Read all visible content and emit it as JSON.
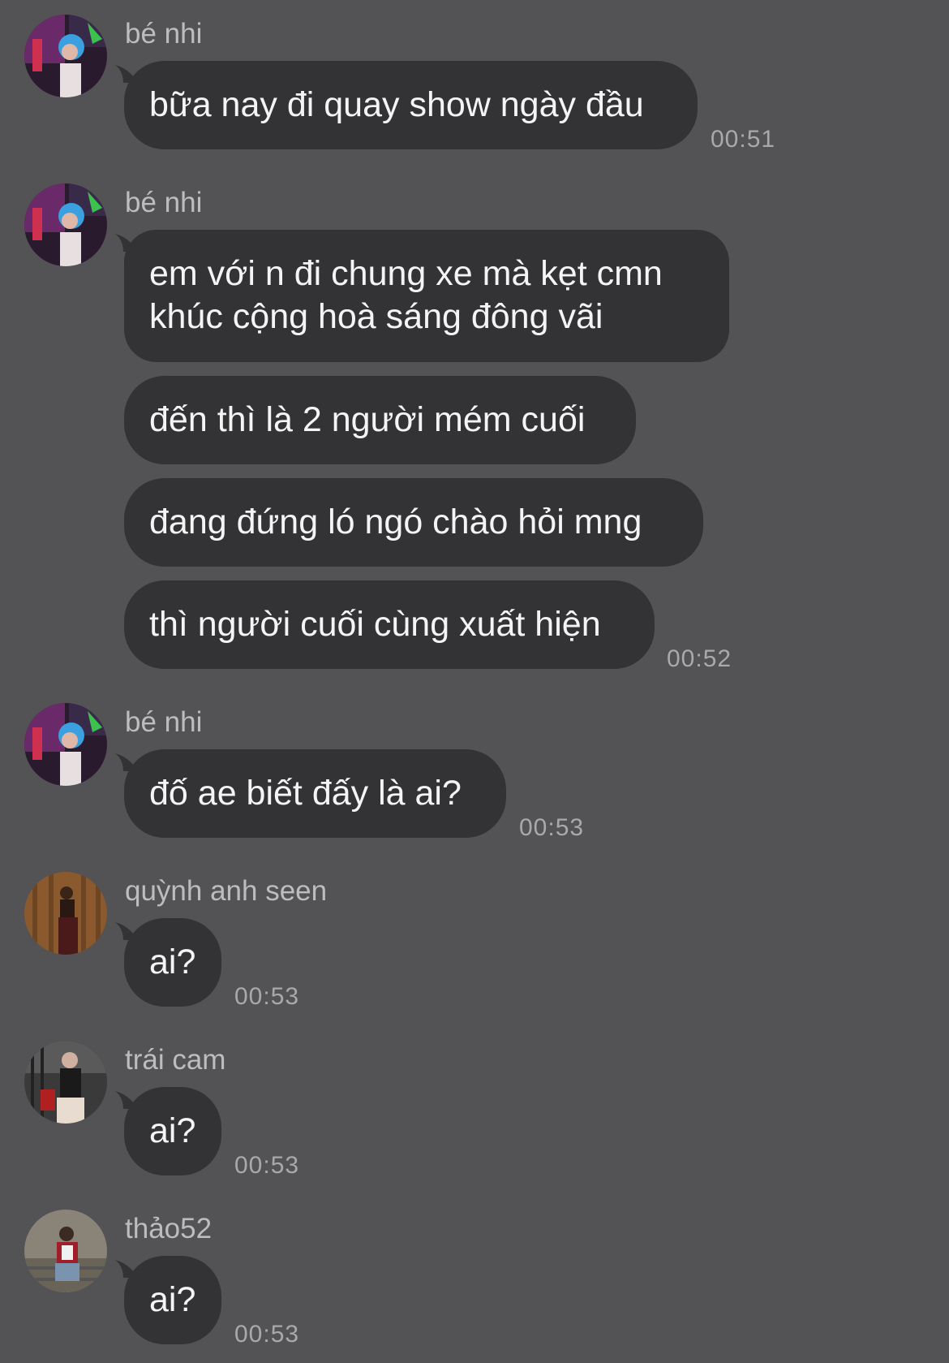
{
  "messages": [
    {
      "sender": "bé nhi",
      "avatar_icon": "avatar-be-nhi-icon",
      "bubbles": [
        "bữa nay đi quay show ngày đầu"
      ],
      "time": "00:51"
    },
    {
      "sender": "bé nhi",
      "avatar_icon": "avatar-be-nhi-icon",
      "bubbles": [
        "em với n đi chung xe mà kẹt cmn khúc cộng hoà sáng đông vãi",
        "đến thì là 2 người mém cuối",
        "đang đứng ló ngó chào hỏi mng",
        "thì người cuối cùng xuất hiện"
      ],
      "time": "00:52"
    },
    {
      "sender": "bé nhi",
      "avatar_icon": "avatar-be-nhi-icon",
      "bubbles": [
        "đố ae biết đấy là ai?"
      ],
      "time": "00:53"
    },
    {
      "sender": "quỳnh anh seen",
      "avatar_icon": "avatar-quynh-anh-icon",
      "bubbles": [
        "ai?"
      ],
      "time": "00:53"
    },
    {
      "sender": "trái cam",
      "avatar_icon": "avatar-trai-cam-icon",
      "bubbles": [
        "ai?"
      ],
      "time": "00:53"
    },
    {
      "sender": "thảo52",
      "avatar_icon": "avatar-thao52-icon",
      "bubbles": [
        "ai?"
      ],
      "time": "00:53"
    }
  ],
  "colors": {
    "background": "#535254",
    "bubble": "#333235",
    "text": "#f4f4f4",
    "sender": "#bdbcbe",
    "timestamp": "#a9a8aa"
  }
}
